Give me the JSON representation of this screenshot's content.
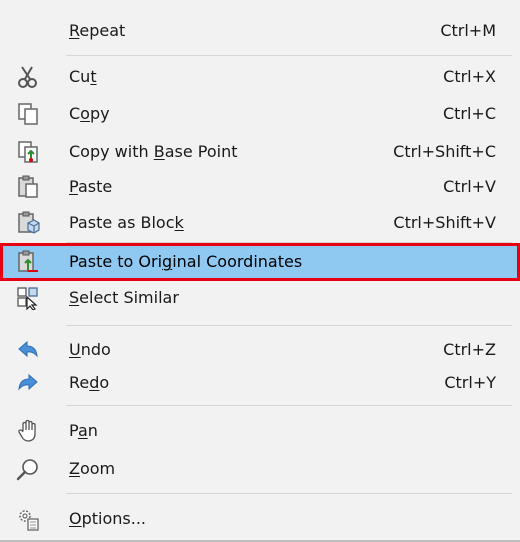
{
  "menu": {
    "items": [
      {
        "pre": "",
        "u": "R",
        "post": "epeat",
        "shortcut": "Ctrl+M",
        "icon": "none"
      },
      {
        "pre": "Cu",
        "u": "t",
        "post": "",
        "shortcut": "Ctrl+X",
        "icon": "scissors-icon"
      },
      {
        "pre": "C",
        "u": "o",
        "post": "py",
        "shortcut": "Ctrl+C",
        "icon": "copy-icon"
      },
      {
        "pre": "Copy with ",
        "u": "B",
        "post": "ase Point",
        "shortcut": "Ctrl+Shift+C",
        "icon": "copy-base-point-icon"
      },
      {
        "pre": "",
        "u": "P",
        "post": "aste",
        "shortcut": "Ctrl+V",
        "icon": "paste-icon"
      },
      {
        "pre": "Paste as Bloc",
        "u": "k",
        "post": "",
        "shortcut": "Ctrl+Shift+V",
        "icon": "paste-as-block-icon"
      },
      {
        "pre": "Paste to Ori",
        "u": "g",
        "post": "inal Coordinates",
        "shortcut": "",
        "icon": "paste-original-coordinates-icon",
        "highlighted": true
      },
      {
        "pre": "",
        "u": "S",
        "post": "elect Similar",
        "shortcut": "",
        "icon": "select-similar-icon"
      },
      {
        "pre": "",
        "u": "U",
        "post": "ndo",
        "shortcut": "Ctrl+Z",
        "icon": "undo-icon"
      },
      {
        "pre": "Re",
        "u": "d",
        "post": "o",
        "shortcut": "Ctrl+Y",
        "icon": "redo-icon"
      },
      {
        "pre": "P",
        "u": "a",
        "post": "n",
        "shortcut": "",
        "icon": "hand-pan-icon"
      },
      {
        "pre": "",
        "u": "Z",
        "post": "oom",
        "shortcut": "",
        "icon": "zoom-magnifier-icon"
      },
      {
        "pre": "",
        "u": "O",
        "post": "ptions...",
        "shortcut": "",
        "icon": "options-gear-icon"
      }
    ]
  },
  "colors": {
    "menu_background": "#f2f2f2",
    "highlight": "#8fc9f2",
    "highlight_border": "#e60012",
    "separator": "#d6d6d6",
    "arrow_blue": "#4a90d9"
  }
}
